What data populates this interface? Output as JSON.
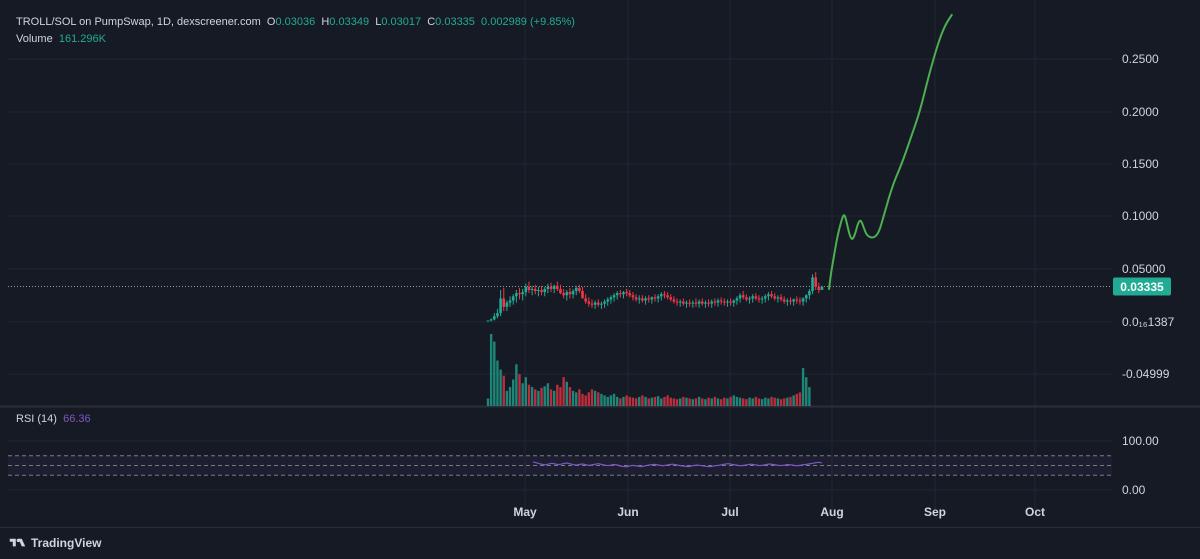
{
  "header": {
    "pair": "TROLL/SOL on PumpSwap, 1D, dexscreener.com",
    "open_label": "O",
    "open": "0.03036",
    "high_label": "H",
    "high": "0.03349",
    "low_label": "L",
    "low": "0.03017",
    "close_label": "C",
    "close": "0.03335",
    "change": "0.002989 (+9.85%)",
    "volume_label": "Volume",
    "volume": "161.296K",
    "rsi_label": "RSI (14)",
    "rsi_value": "66.36"
  },
  "brand": {
    "name": "TradingView"
  },
  "colors": {
    "background": "#161a25",
    "grid": "#232632",
    "up": "#22ab94",
    "down": "#f23645",
    "projection": "#4caf50",
    "rsi": "#7e57c2",
    "price_tag": "#22ab94"
  },
  "chart_data": [
    {
      "type": "candlestick",
      "title": "TROLL/SOL on PumpSwap, 1D, dexscreener.com",
      "x_ticks": [
        "May",
        "Jun",
        "Jul",
        "Aug",
        "Sep",
        "Oct"
      ],
      "y_ticks": [
        "0.2500",
        "0.2000",
        "0.1500",
        "0.1000",
        "0.05000",
        "0.0₁₆1387",
        "-0.04999"
      ],
      "ylim": [
        -0.065,
        0.29
      ],
      "current_price": "0.03335",
      "candles_ohlc": [
        [
          0.0,
          0.001,
          0.0,
          0.001
        ],
        [
          0.001,
          0.003,
          0.0,
          0.002
        ],
        [
          0.002,
          0.008,
          0.001,
          0.005
        ],
        [
          0.005,
          0.012,
          0.003,
          0.008
        ],
        [
          0.008,
          0.03,
          0.005,
          0.022
        ],
        [
          0.022,
          0.032,
          0.01,
          0.014
        ],
        [
          0.014,
          0.02,
          0.01,
          0.018
        ],
        [
          0.018,
          0.024,
          0.014,
          0.02
        ],
        [
          0.02,
          0.026,
          0.016,
          0.024
        ],
        [
          0.024,
          0.03,
          0.018,
          0.027
        ],
        [
          0.027,
          0.032,
          0.021,
          0.026
        ],
        [
          0.026,
          0.031,
          0.02,
          0.028
        ],
        [
          0.028,
          0.036,
          0.024,
          0.033
        ],
        [
          0.033,
          0.038,
          0.027,
          0.03
        ],
        [
          0.03,
          0.034,
          0.025,
          0.031
        ],
        [
          0.031,
          0.035,
          0.026,
          0.029
        ],
        [
          0.029,
          0.033,
          0.024,
          0.03
        ],
        [
          0.03,
          0.034,
          0.025,
          0.028
        ],
        [
          0.028,
          0.033,
          0.024,
          0.031
        ],
        [
          0.031,
          0.036,
          0.027,
          0.033
        ],
        [
          0.033,
          0.037,
          0.028,
          0.031
        ],
        [
          0.031,
          0.035,
          0.027,
          0.034
        ],
        [
          0.034,
          0.038,
          0.029,
          0.031
        ],
        [
          0.031,
          0.035,
          0.026,
          0.027
        ],
        [
          0.027,
          0.031,
          0.022,
          0.025
        ],
        [
          0.025,
          0.03,
          0.02,
          0.028
        ],
        [
          0.028,
          0.032,
          0.022,
          0.026
        ],
        [
          0.026,
          0.031,
          0.022,
          0.029
        ],
        [
          0.029,
          0.034,
          0.025,
          0.032
        ],
        [
          0.032,
          0.035,
          0.027,
          0.029
        ],
        [
          0.029,
          0.033,
          0.024,
          0.022
        ],
        [
          0.022,
          0.026,
          0.017,
          0.019
        ],
        [
          0.019,
          0.023,
          0.014,
          0.017
        ],
        [
          0.017,
          0.021,
          0.013,
          0.016
        ],
        [
          0.016,
          0.02,
          0.012,
          0.018
        ],
        [
          0.018,
          0.021,
          0.014,
          0.016
        ],
        [
          0.016,
          0.019,
          0.012,
          0.017
        ],
        [
          0.017,
          0.021,
          0.013,
          0.019
        ],
        [
          0.019,
          0.023,
          0.015,
          0.021
        ],
        [
          0.021,
          0.025,
          0.017,
          0.023
        ],
        [
          0.023,
          0.027,
          0.019,
          0.025
        ],
        [
          0.025,
          0.029,
          0.021,
          0.027
        ],
        [
          0.027,
          0.03,
          0.023,
          0.026
        ],
        [
          0.026,
          0.029,
          0.022,
          0.028
        ],
        [
          0.028,
          0.031,
          0.024,
          0.027
        ],
        [
          0.027,
          0.03,
          0.023,
          0.025
        ],
        [
          0.025,
          0.028,
          0.02,
          0.023
        ],
        [
          0.023,
          0.026,
          0.019,
          0.021
        ],
        [
          0.021,
          0.025,
          0.017,
          0.022
        ],
        [
          0.022,
          0.025,
          0.018,
          0.02
        ],
        [
          0.02,
          0.024,
          0.016,
          0.022
        ],
        [
          0.022,
          0.025,
          0.018,
          0.021
        ],
        [
          0.021,
          0.024,
          0.017,
          0.023
        ],
        [
          0.023,
          0.026,
          0.019,
          0.022
        ],
        [
          0.022,
          0.026,
          0.018,
          0.024
        ],
        [
          0.024,
          0.028,
          0.02,
          0.026
        ],
        [
          0.026,
          0.029,
          0.022,
          0.025
        ],
        [
          0.025,
          0.028,
          0.021,
          0.023
        ],
        [
          0.023,
          0.026,
          0.019,
          0.021
        ],
        [
          0.021,
          0.024,
          0.017,
          0.019
        ],
        [
          0.019,
          0.022,
          0.015,
          0.018
        ],
        [
          0.018,
          0.021,
          0.014,
          0.019
        ],
        [
          0.019,
          0.022,
          0.015,
          0.017
        ],
        [
          0.017,
          0.02,
          0.013,
          0.018
        ],
        [
          0.018,
          0.021,
          0.014,
          0.017
        ],
        [
          0.017,
          0.02,
          0.013,
          0.018
        ],
        [
          0.018,
          0.022,
          0.014,
          0.017
        ],
        [
          0.017,
          0.021,
          0.013,
          0.019
        ],
        [
          0.019,
          0.022,
          0.015,
          0.017
        ],
        [
          0.017,
          0.02,
          0.013,
          0.018
        ],
        [
          0.018,
          0.021,
          0.014,
          0.017
        ],
        [
          0.017,
          0.021,
          0.013,
          0.019
        ],
        [
          0.019,
          0.022,
          0.015,
          0.018
        ],
        [
          0.018,
          0.022,
          0.014,
          0.02
        ],
        [
          0.02,
          0.023,
          0.016,
          0.019
        ],
        [
          0.019,
          0.022,
          0.015,
          0.018
        ],
        [
          0.018,
          0.021,
          0.014,
          0.019
        ],
        [
          0.019,
          0.022,
          0.015,
          0.018
        ],
        [
          0.018,
          0.021,
          0.014,
          0.02
        ],
        [
          0.02,
          0.024,
          0.016,
          0.022
        ],
        [
          0.022,
          0.027,
          0.018,
          0.025
        ],
        [
          0.025,
          0.029,
          0.021,
          0.023
        ],
        [
          0.023,
          0.026,
          0.019,
          0.021
        ],
        [
          0.021,
          0.024,
          0.017,
          0.022
        ],
        [
          0.022,
          0.026,
          0.018,
          0.024
        ],
        [
          0.024,
          0.027,
          0.02,
          0.022
        ],
        [
          0.022,
          0.025,
          0.018,
          0.021
        ],
        [
          0.021,
          0.024,
          0.017,
          0.022
        ],
        [
          0.022,
          0.026,
          0.018,
          0.024
        ],
        [
          0.024,
          0.028,
          0.02,
          0.026
        ],
        [
          0.026,
          0.029,
          0.022,
          0.024
        ],
        [
          0.024,
          0.027,
          0.02,
          0.022
        ],
        [
          0.022,
          0.025,
          0.018,
          0.023
        ],
        [
          0.023,
          0.026,
          0.019,
          0.021
        ],
        [
          0.021,
          0.024,
          0.017,
          0.019
        ],
        [
          0.019,
          0.022,
          0.015,
          0.02
        ],
        [
          0.02,
          0.023,
          0.016,
          0.019
        ],
        [
          0.019,
          0.022,
          0.015,
          0.021
        ],
        [
          0.021,
          0.024,
          0.017,
          0.02
        ],
        [
          0.02,
          0.023,
          0.016,
          0.019
        ],
        [
          0.019,
          0.023,
          0.015,
          0.022
        ],
        [
          0.022,
          0.026,
          0.018,
          0.025
        ],
        [
          0.025,
          0.031,
          0.021,
          0.029
        ],
        [
          0.029,
          0.045,
          0.026,
          0.042
        ],
        [
          0.042,
          0.047,
          0.03,
          0.033
        ],
        [
          0.033,
          0.037,
          0.027,
          0.03
        ],
        [
          0.03,
          0.034,
          0.03,
          0.033
        ]
      ],
      "volume": [
        10,
        95,
        85,
        60,
        48,
        40,
        20,
        25,
        35,
        55,
        42,
        30,
        38,
        28,
        25,
        22,
        20,
        24,
        26,
        30,
        22,
        20,
        28,
        25,
        38,
        32,
        25,
        20,
        18,
        22,
        16,
        14,
        18,
        22,
        20,
        18,
        16,
        14,
        12,
        14,
        16,
        12,
        10,
        12,
        14,
        12,
        11,
        10,
        12,
        14,
        12,
        10,
        11,
        12,
        13,
        10,
        12,
        14,
        11,
        10,
        9,
        10,
        12,
        11,
        10,
        9,
        10,
        12,
        10,
        9,
        11,
        10,
        12,
        10,
        9,
        11,
        10,
        12,
        14,
        12,
        11,
        10,
        9,
        11,
        10,
        12,
        10,
        9,
        11,
        10,
        12,
        11,
        10,
        9,
        10,
        11,
        12,
        14,
        16,
        18,
        50,
        38,
        25
      ],
      "projection_curve": [
        [
          0.0,
          0.031
        ],
        [
          0.004,
          0.045
        ],
        [
          0.01,
          0.06
        ],
        [
          0.018,
          0.08
        ],
        [
          0.026,
          0.094
        ],
        [
          0.032,
          0.102
        ],
        [
          0.036,
          0.1
        ],
        [
          0.041,
          0.09
        ],
        [
          0.047,
          0.08
        ],
        [
          0.052,
          0.078
        ],
        [
          0.058,
          0.084
        ],
        [
          0.064,
          0.094
        ],
        [
          0.07,
          0.097
        ],
        [
          0.076,
          0.09
        ],
        [
          0.082,
          0.083
        ],
        [
          0.09,
          0.08
        ],
        [
          0.1,
          0.08
        ],
        [
          0.11,
          0.085
        ],
        [
          0.12,
          0.1
        ],
        [
          0.14,
          0.13
        ],
        [
          0.16,
          0.15
        ],
        [
          0.18,
          0.175
        ],
        [
          0.2,
          0.2
        ],
        [
          0.22,
          0.235
        ],
        [
          0.24,
          0.265
        ],
        [
          0.255,
          0.282
        ],
        [
          0.27,
          0.292
        ]
      ]
    },
    {
      "type": "line",
      "title": "RSI (14)",
      "y_ticks": [
        "100.00",
        "0.00"
      ],
      "bands": [
        70,
        50,
        30
      ],
      "rsi_values": [
        72,
        68,
        62,
        58,
        55,
        60,
        64,
        61,
        57,
        59,
        63,
        66,
        61,
        57,
        54,
        58,
        60,
        56,
        52,
        55,
        59,
        62,
        58,
        54,
        51,
        53,
        57,
        55,
        49,
        46,
        44,
        48,
        52,
        50,
        47,
        45,
        49,
        53,
        56,
        58,
        55,
        52,
        50,
        54,
        57,
        59,
        56,
        52,
        49,
        47,
        45,
        48,
        52,
        54,
        51,
        48,
        46,
        45,
        48,
        51,
        53,
        57,
        60,
        62,
        58,
        55,
        52,
        50,
        53,
        56,
        59,
        57,
        54,
        51,
        53,
        57,
        60,
        58,
        55,
        52,
        51,
        54,
        57,
        55,
        52,
        50,
        53,
        56,
        58,
        61,
        64,
        68,
        70,
        66.36
      ]
    }
  ]
}
